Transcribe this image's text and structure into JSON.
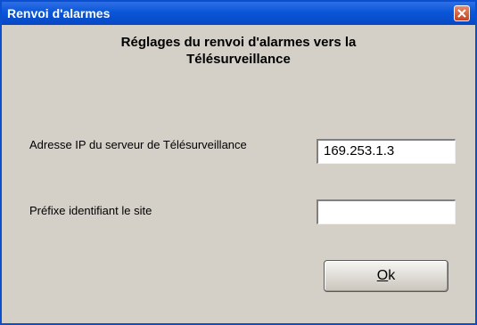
{
  "window": {
    "title": "Renvoi d'alarmes"
  },
  "heading": {
    "line1": "Réglages du renvoi d'alarmes vers la",
    "line2": "Télésurveillance"
  },
  "form": {
    "ip_label": "Adresse IP du serveur de Télésurveillance",
    "ip_value": "169.253.1.3",
    "prefix_label": "Préfixe identifiant le site",
    "prefix_value": ""
  },
  "buttons": {
    "ok_mnemonic": "O",
    "ok_rest": "k"
  },
  "icons": {
    "close": "close-icon"
  },
  "colors": {
    "titlebar": "#0a56d8",
    "dialog_bg": "#d4d0c8",
    "close_button": "#c2441f"
  }
}
